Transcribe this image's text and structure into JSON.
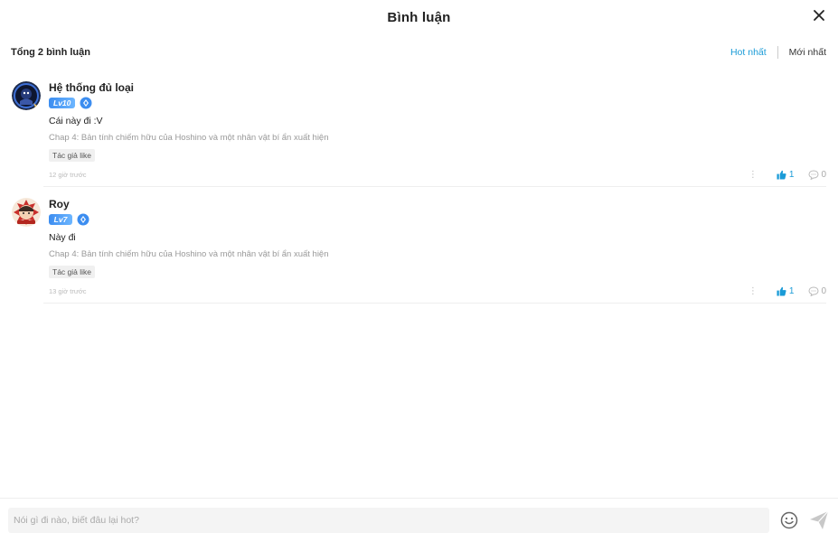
{
  "header": {
    "title": "Bình luận",
    "close_icon": "close-icon"
  },
  "toolbar": {
    "total": "Tổng 2 bình luận",
    "sort_hot": "Hot nhất",
    "sort_new": "Mới nhất"
  },
  "colors": {
    "accent": "#1a9bd7",
    "level_badge": "#3c8df0"
  },
  "comments": [
    {
      "name": "Hệ thống đủ loại",
      "level": "Lv10",
      "text": "Cái này đi :V",
      "chapter": "Chap 4: Bản tính chiếm hữu của Hoshino và một nhân vật bí ẩn xuất hiện",
      "tag": "Tác giả like",
      "time": "12 giờ trước",
      "likes": "1",
      "replies": "0"
    },
    {
      "name": "Roy",
      "level": "Lv7",
      "text": "Này đi",
      "chapter": "Chap 4: Bản tính chiếm hữu của Hoshino và một nhân vật bí ẩn xuất hiện",
      "tag": "Tác giả like",
      "time": "13 giờ trước",
      "likes": "1",
      "replies": "0"
    }
  ],
  "composer": {
    "placeholder": "Nói gì đi nào, biết đâu lại hot?",
    "value": ""
  }
}
